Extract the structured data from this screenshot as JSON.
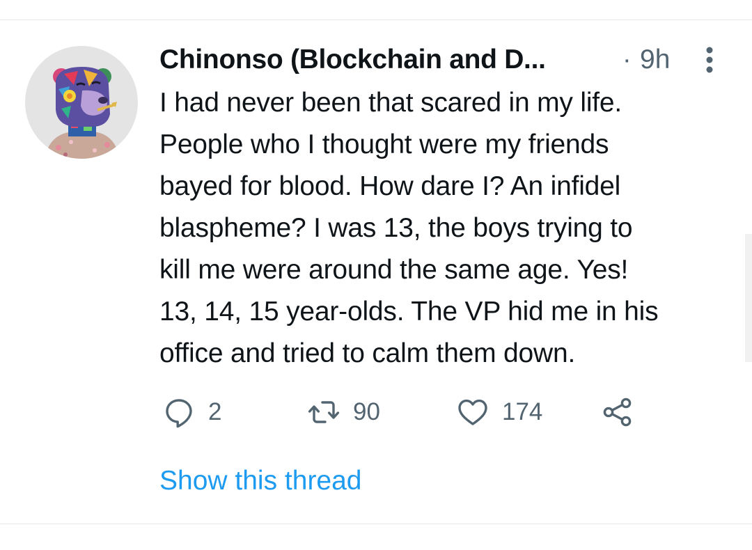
{
  "tweet": {
    "author_name": "Chinonso (Blockchain and D...",
    "time_separator": "·",
    "time": "9h",
    "text": "I had never been that scared in my life.\nPeople who I thought were my friends\nbayed for blood. How dare I? An infidel\nblaspheme? I was 13, the boys trying to\nkill me were around the same age. Yes!\n13, 14, 15 year-olds. The VP hid me in his\noffice and tried to calm them down.",
    "actions": {
      "reply": {
        "icon": "reply-icon",
        "count": "2"
      },
      "retweet": {
        "icon": "retweet-icon",
        "count": "90"
      },
      "like": {
        "icon": "heart-icon",
        "count": "174"
      },
      "share": {
        "icon": "share-icon"
      }
    },
    "show_thread": "Show this thread",
    "more_icon": "more-vertical-icon",
    "avatar_icon": "nft-bear-avatar"
  },
  "colors": {
    "text_primary": "#0f1419",
    "text_secondary": "#536471",
    "link_blue": "#1d9bf0",
    "divider": "#e6e9eb"
  }
}
